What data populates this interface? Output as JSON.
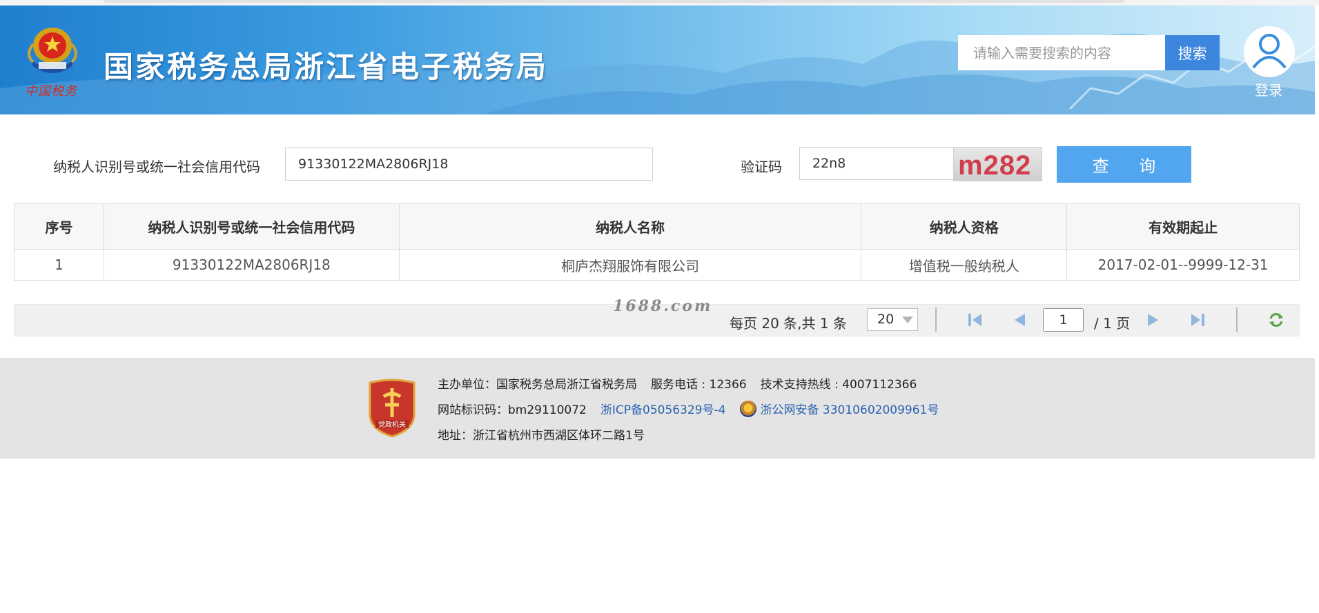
{
  "header": {
    "title": "国家税务总局浙江省电子税务局",
    "emblem_script": "中国税务",
    "search_placeholder": "请输入需要搜索的内容",
    "search_button": "搜索",
    "login_label": "登录"
  },
  "form": {
    "tax_id_label": "纳税人识别号或统一社会信用代码",
    "tax_id_value": "91330122MA2806RJ18",
    "captcha_label": "验证码",
    "captcha_value": "22n8",
    "captcha_image_text": "m282",
    "query_button": "查 询"
  },
  "table": {
    "headers": [
      "序号",
      "纳税人识别号或统一社会信用代码",
      "纳税人名称",
      "纳税人资格",
      "有效期起止"
    ],
    "rows": [
      [
        "1",
        "91330122MA2806RJ18",
        "桐庐杰翔服饰有限公司",
        "增值税一般纳税人",
        "2017-02-01--9999-12-31"
      ]
    ]
  },
  "pager": {
    "watermark": "1688.com",
    "info": "每页 20 条,共 1 条",
    "page_size": "20",
    "current_page": "1",
    "total_pages": "/ 1 页"
  },
  "footer": {
    "line1_host": "主办单位：国家税务总局浙江省税务局",
    "line1_phone": "服务电话 : 12366",
    "line1_support": "技术支持热线 : 4007112366",
    "line2_site_code": "网站标识码：bm29110072",
    "line2_icp": "浙ICP备05056329号-4",
    "line2_police": "浙公网安备 33010602009961号",
    "line3_address": "地址：浙江省杭州市西湖区体环二路1号",
    "badge_text": "党政机关"
  },
  "colors": {
    "header_blue": "#1f7fcf",
    "search_button": "#3c86dd",
    "query_button": "#52a5ef",
    "captcha_text": "#d23d4c",
    "link_blue": "#2a62b0"
  }
}
